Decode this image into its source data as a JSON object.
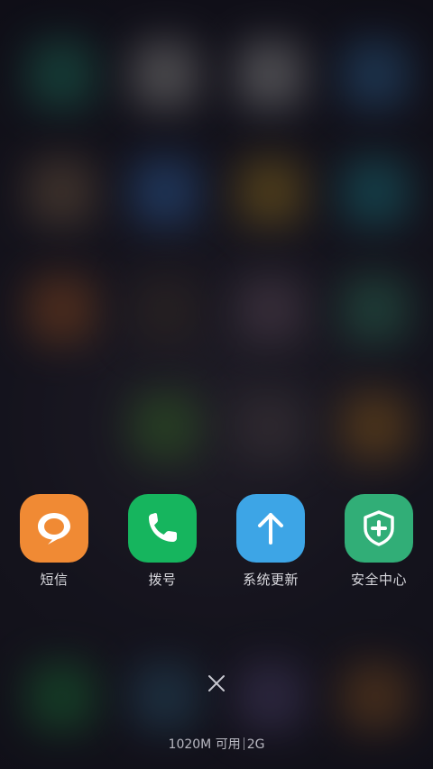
{
  "apps": [
    {
      "name": "messages",
      "label": "短信",
      "icon": "chat-bubble-icon",
      "color": "#F08A34"
    },
    {
      "name": "dialer",
      "label": "拨号",
      "icon": "phone-icon",
      "color": "#16B55E"
    },
    {
      "name": "system-update",
      "label": "系统更新",
      "icon": "arrow-up-icon",
      "color": "#3DA5E6"
    },
    {
      "name": "security-center",
      "label": "安全中心",
      "icon": "shield-plus-icon",
      "color": "#31AE77"
    }
  ],
  "close": {
    "icon": "close-icon"
  },
  "memory": {
    "available": "1020M 可用",
    "total": "2G"
  }
}
